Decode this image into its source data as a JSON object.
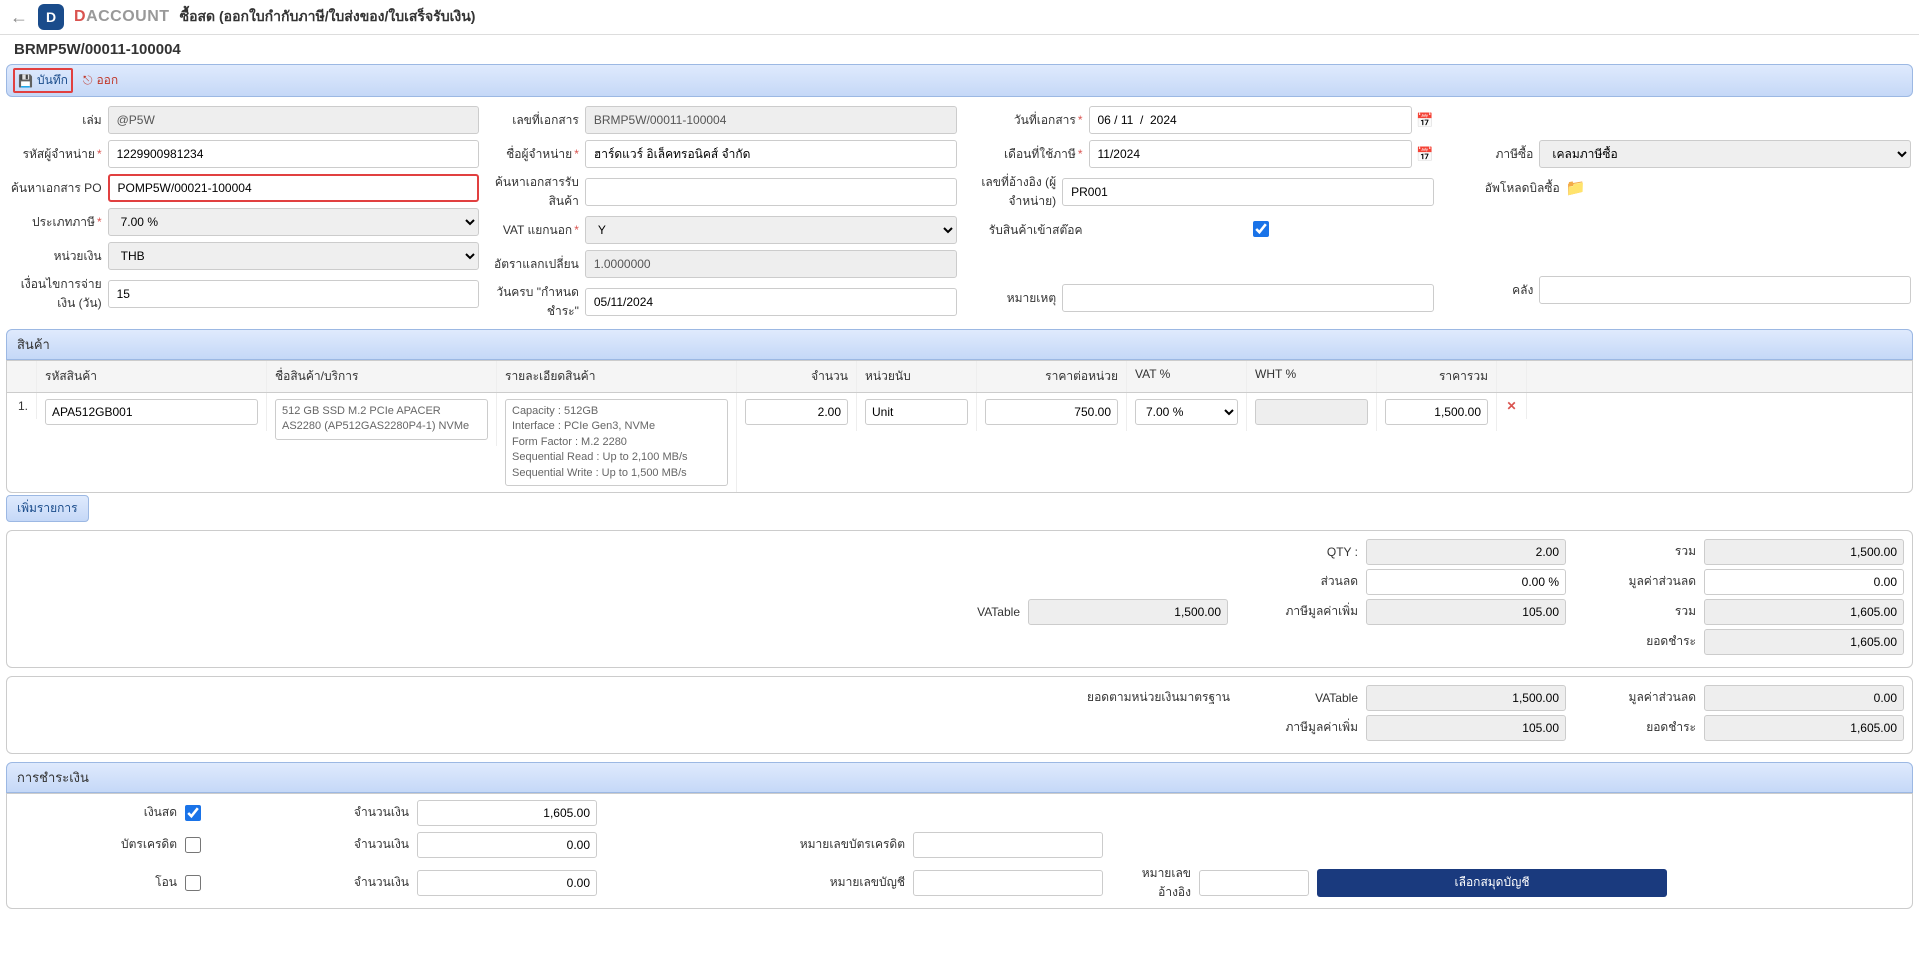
{
  "header": {
    "brand1": "D",
    "brand2": "ACCOUNT",
    "page_title": "ซื้อสด (ออกใบกำกับภาษี/ใบส่งของ/ใบเสร็จรับเงิน)",
    "doc_no": "BRMP5W/00011-100004"
  },
  "toolbar": {
    "save": "บันทึก",
    "exit": "ออก"
  },
  "form": {
    "labels": {
      "book": "เล่ม",
      "vendor_code": "รหัสผู้จำหน่าย",
      "search_po": "ค้นหาเอกสาร PO",
      "tax_type": "ประเภทภาษี",
      "currency": "หน่วยเงิน",
      "payment_term": "เงื่อนไขการจ่ายเงิน (วัน)",
      "doc_no": "เลขที่เอกสาร",
      "vendor_name": "ชื่อผู้จำหน่าย",
      "search_receive": "ค้นหาเอกสารรับสินค้า",
      "vat_extract": "VAT แยกนอก",
      "exchange_rate": "อัตราแลกเปลี่ยน",
      "due_date": "วันครบ \"กำหนดชำระ\"",
      "doc_date": "วันที่เอกสาร",
      "tax_month": "เดือนที่ใช้ภาษี",
      "ref_no": "เลขที่อ้างอิง (ผู้จำหน่าย)",
      "receive_stock": "รับสินค้าเข้าสต๊อค",
      "remark": "หมายเหตุ",
      "buy_tax": "ภาษีซื้อ",
      "upload_bill": "อัพโหลดบิลซื้อ",
      "warehouse": "คลัง"
    },
    "values": {
      "book": "@P5W",
      "vendor_code": "1229900981234",
      "search_po": "POMP5W/00021-100004",
      "tax_type": "7.00 %",
      "currency": "THB",
      "payment_term": "15",
      "doc_no": "BRMP5W/00011-100004",
      "vendor_name": "ฮาร์ดแวร์ อิเล็คทรอนิคส์ จำกัด",
      "search_receive": "",
      "vat_extract": "Y",
      "exchange_rate": "1.0000000",
      "due_date": "05/11/2024",
      "doc_date": "06 / 11  /  2024",
      "tax_month": "11/2024",
      "ref_no": "PR001",
      "remark": "",
      "buy_tax": "เคลมภาษีซื้อ",
      "warehouse": ""
    }
  },
  "grid": {
    "title": "สินค้า",
    "headers": {
      "code": "รหัสสินค้า",
      "name": "ชื่อสินค้า/บริการ",
      "desc": "รายละเอียดสินค้า",
      "qty": "จำนวน",
      "unit": "หน่วยนับ",
      "unitprice": "ราคาต่อหน่วย",
      "vat": "VAT %",
      "wht": "WHT %",
      "total": "ราคารวม"
    },
    "rows": [
      {
        "num": "1.",
        "code": "APA512GB001",
        "name": "512 GB SSD M.2 PCIe APACER AS2280 (AP512GAS2280P4-1) NVMe",
        "desc": "Capacity : 512GB\nInterface : PCIe Gen3, NVMe\nForm Factor : M.2 2280\nSequential Read : Up to 2,100 MB/s\nSequential Write : Up to 1,500 MB/s",
        "qty": "2.00",
        "unit": "Unit",
        "unitprice": "750.00",
        "vat": "7.00 %",
        "wht": "",
        "total": "1,500.00"
      }
    ],
    "add_item": "เพิ่มรายการ"
  },
  "totals": {
    "labels": {
      "qty": "QTY :",
      "sum": "รวม",
      "discount": "ส่วนลด",
      "discount_amt": "มูลค่าส่วนลด",
      "vatable": "VATable",
      "vat_amt": "ภาษีมูลค่าเพิ่ม",
      "grand": "รวม",
      "payable": "ยอดชำระ",
      "std_currency": "ยอดตามหน่วยเงินมาตรฐาน"
    },
    "values": {
      "qty": "2.00",
      "sum": "1,500.00",
      "discount": "0.00 %",
      "discount_amt": "0.00",
      "vatable": "1,500.00",
      "vat_amt": "105.00",
      "grand": "1,605.00",
      "payable": "1,605.00",
      "std_vatable": "1,500.00",
      "std_discount_amt": "0.00",
      "std_vat_amt": "105.00",
      "std_payable": "1,605.00"
    }
  },
  "payment": {
    "title": "การชำระเงิน",
    "labels": {
      "cash": "เงินสด",
      "credit": "บัตรเครดิต",
      "transfer": "โอน",
      "amount": "จำนวนเงิน",
      "credit_no": "หมายเลขบัตรเครดิต",
      "acct_no": "หมายเลขบัญชี",
      "ref_no": "หมายเลขอ้างอิง",
      "select_acct": "เลือกสมุดบัญชี"
    },
    "values": {
      "cash_checked": true,
      "cash_amt": "1,605.00",
      "credit_checked": false,
      "credit_amt": "0.00",
      "credit_no": "",
      "transfer_checked": false,
      "transfer_amt": "0.00",
      "acct_no": "",
      "ref_no": ""
    }
  }
}
